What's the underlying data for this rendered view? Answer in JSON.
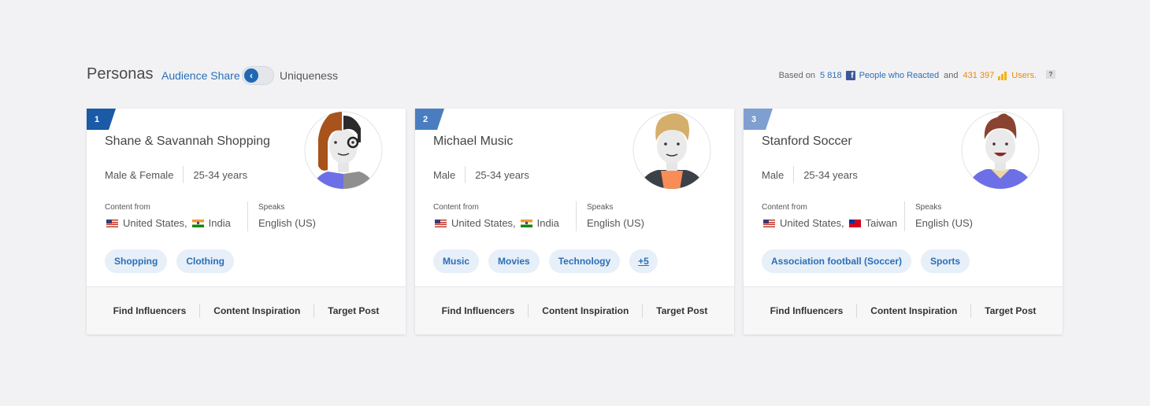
{
  "header": {
    "title": "Personas",
    "audience_share": "Audience Share",
    "toggle_glyph": "‹",
    "uniqueness": "Uniqueness",
    "based_on": "Based on",
    "people_count": "5 818",
    "people_label": "People who Reacted",
    "and": "and",
    "users_count": "431 397",
    "users_label": "Users.",
    "help": "?"
  },
  "colors": {
    "accent": "#2a6fb8",
    "rank1": "#1a5aa6",
    "rank2": "#4a7dc0",
    "rank3": "#7f9fd0",
    "orange": "#e58a12"
  },
  "cards": [
    {
      "rank": "1",
      "name": "Shane & Savannah Shopping",
      "gender": "Male & Female",
      "age": "25-34 years",
      "content_from_label": "Content from",
      "country1": "United States,",
      "country2": "India",
      "speaks_label": "Speaks",
      "language": "English (US)",
      "tags": [
        "Shopping",
        "Clothing"
      ],
      "actions": [
        "Find Influencers",
        "Content Inspiration",
        "Target Post"
      ]
    },
    {
      "rank": "2",
      "name": "Michael Music",
      "gender": "Male",
      "age": "25-34 years",
      "content_from_label": "Content from",
      "country1": "United States,",
      "country2": "India",
      "speaks_label": "Speaks",
      "language": "English (US)",
      "tags": [
        "Music",
        "Movies",
        "Technology"
      ],
      "more": "+5",
      "actions": [
        "Find Influencers",
        "Content Inspiration",
        "Target Post"
      ]
    },
    {
      "rank": "3",
      "name": "Stanford Soccer",
      "gender": "Male",
      "age": "25-34 years",
      "content_from_label": "Content from",
      "country1": "United States,",
      "country2": "Taiwan",
      "speaks_label": "Speaks",
      "language": "English (US)",
      "tags": [
        "Association football (Soccer)",
        "Sports"
      ],
      "actions": [
        "Find Influencers",
        "Content Inspiration",
        "Target Post"
      ]
    }
  ]
}
